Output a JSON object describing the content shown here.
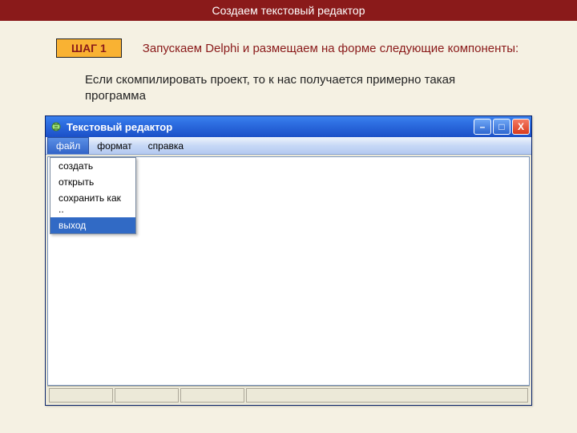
{
  "header": {
    "title": "Создаем текстовый редактор"
  },
  "step": {
    "badge": "ШАГ 1",
    "text": "Запускаем Delphi и размещаем на форме следующие компоненты:"
  },
  "description": "Если скомпилировать проект, то к нас получается примерно такая программа",
  "window": {
    "title": "Текстовый редактор",
    "icons": {
      "app": "app-icon",
      "minimize": "–",
      "maximize": "□",
      "close": "X"
    },
    "menubar": {
      "items": [
        {
          "label": "файл",
          "active": true
        },
        {
          "label": "формат",
          "active": false
        },
        {
          "label": "справка",
          "active": false
        }
      ]
    },
    "dropdown": {
      "items": [
        {
          "label": "создать",
          "hover": false
        },
        {
          "label": "открыть",
          "hover": false
        },
        {
          "label": "сохранить как ..",
          "hover": false
        },
        {
          "label": "выход",
          "hover": true
        }
      ]
    }
  }
}
